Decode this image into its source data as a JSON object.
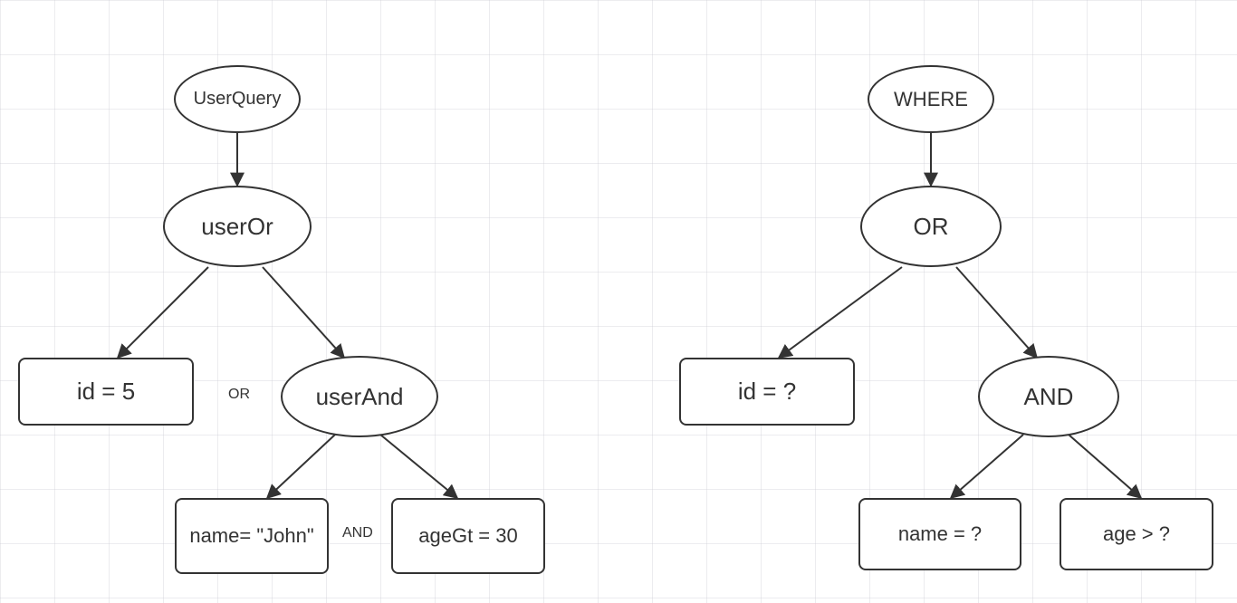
{
  "left_tree": {
    "root": {
      "label": "UserQuery"
    },
    "or": {
      "label": "userOr"
    },
    "id": {
      "label": "id = 5"
    },
    "and": {
      "label": "userAnd"
    },
    "name": {
      "label": "name= \"John\""
    },
    "age": {
      "label": "ageGt = 30"
    },
    "or_connector": "OR",
    "and_connector": "AND"
  },
  "right_tree": {
    "root": {
      "label": "WHERE"
    },
    "or": {
      "label": "OR"
    },
    "id": {
      "label": "id = ?"
    },
    "and": {
      "label": "AND"
    },
    "name": {
      "label": "name = ?"
    },
    "age": {
      "label": "age > ?"
    }
  }
}
